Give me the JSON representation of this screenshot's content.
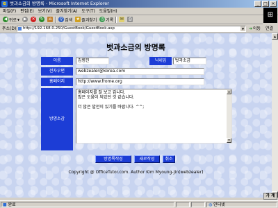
{
  "window": {
    "title": "벗과소금의 방명록 - Microsoft Internet Explorer",
    "controls": [
      "_",
      "□",
      "×"
    ]
  },
  "menu": [
    "파일(F)",
    "편집(E)",
    "보기(V)",
    "즐겨찾기(A)",
    "도구(T)",
    "도움말(H)"
  ],
  "toolbar": {
    "back": "뒤로",
    "search": "검색",
    "favorites": "즐겨찾기",
    "history": "기록"
  },
  "address": {
    "label": "주소(D)",
    "url": "http://192.168.0.250/GuestBook/GuestBook.asp",
    "go": "이동",
    "links": "연결"
  },
  "page": {
    "title": "벗과소금의 방명록",
    "fields": {
      "name_label": "이름",
      "name_value": "김병진",
      "nickname_label": "닉네임",
      "nickname_value": "벗과소금",
      "email_label": "전자우편",
      "email_value": "webzealer@korea.com",
      "homepage_label": "홈페이지",
      "homepage_value": "http://www.frome.org",
      "message_label": "방명소감",
      "message_lines": [
        "홈페이지를 잘 보고 갑니다.",
        "많은 도움이 되었던 것 같습니다.",
        "",
        "더 많은 발전이 있기를 바랍니다. ^^;"
      ]
    },
    "buttons": {
      "submit": "방명록작성",
      "reset": "새로작성",
      "cancel": "취소"
    },
    "copyright": "Copyright @ OfficeTutor.com. Author Kim Myoung-Jin(webzealer)"
  },
  "status": {
    "left": "완료",
    "zone": "인터넷",
    "ime": "가 계"
  }
}
